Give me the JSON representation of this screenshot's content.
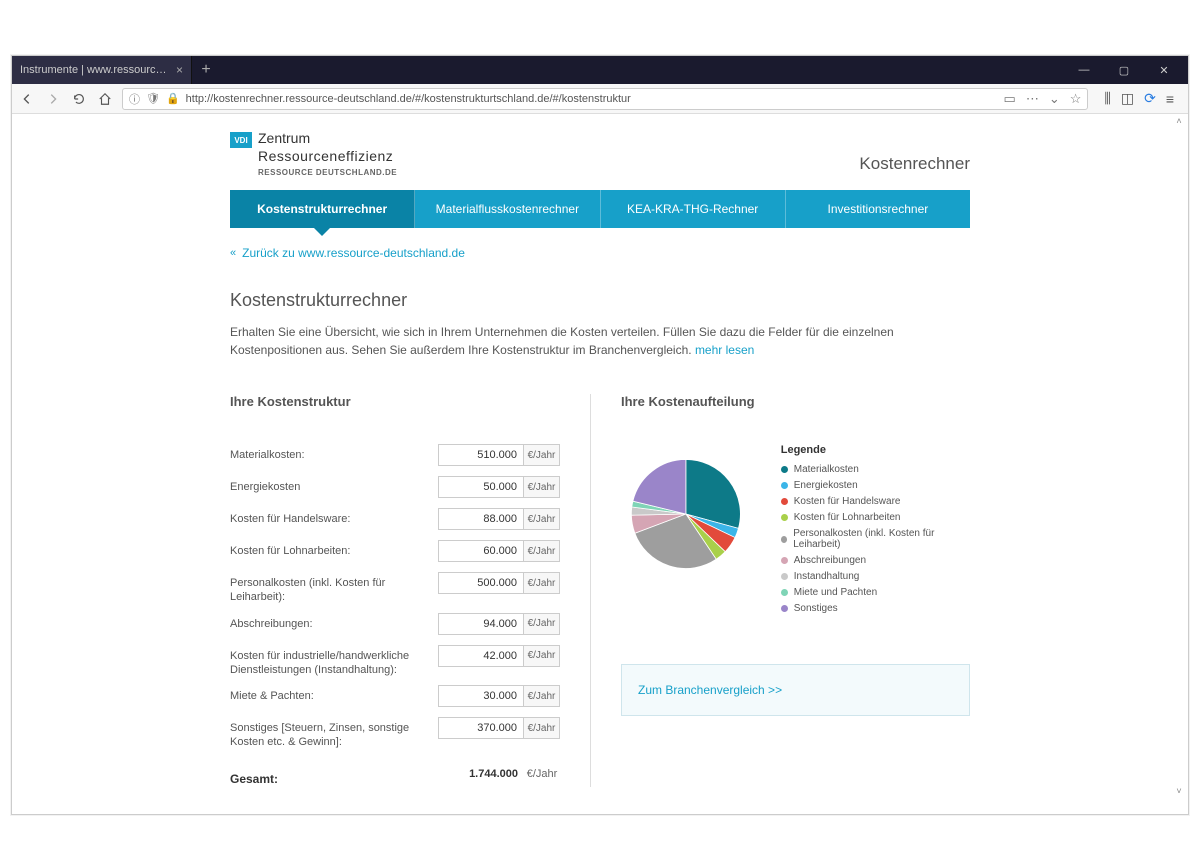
{
  "browser": {
    "tab_title": "Instrumente | www.ressource-deut",
    "url": "http://kostenrechner.ressource-deutschland.de/#/kostenstrukturtschland.de/#/kostenstruktur"
  },
  "brand": {
    "logo": "VDI",
    "line1": "Zentrum",
    "line2": "Ressourceneffizienz",
    "sub": "RESSOURCE DEUTSCHLAND.DE"
  },
  "header_title": "Kostenrechner",
  "nav": {
    "tabs": [
      {
        "label": "Kostenstrukturrechner"
      },
      {
        "label": "Materialflusskostenrechner"
      },
      {
        "label": "KEA-KRA-THG-Rechner"
      },
      {
        "label": "Investitionsrechner"
      }
    ]
  },
  "back_link": "Zurück zu www.ressource-deutschland.de",
  "section": {
    "title": "Kostenstrukturrechner",
    "desc": "Erhalten Sie eine Übersicht, wie sich in Ihrem Unternehmen die Kosten verteilen. Füllen Sie dazu die Felder für die einzelnen Kostenpositionen aus. Sehen Sie außerdem Ihre Kostenstruktur im Branchenvergleich.",
    "more": "mehr lesen"
  },
  "left_heading": "Ihre Kostenstruktur",
  "right_heading": "Ihre Kostenaufteilung",
  "unit": "€/Jahr",
  "costs": [
    {
      "label": "Materialkosten:",
      "value": "510.000"
    },
    {
      "label": "Energiekosten",
      "value": "50.000"
    },
    {
      "label": "Kosten für Handelsware:",
      "value": "88.000"
    },
    {
      "label": "Kosten für Lohnarbeiten:",
      "value": "60.000"
    },
    {
      "label": "Personalkosten (inkl. Kosten für Leiharbeit):",
      "value": "500.000"
    },
    {
      "label": "Abschreibungen:",
      "value": "94.000"
    },
    {
      "label": "Kosten für industrielle/handwerkliche Dienstleistungen (Instandhaltung):",
      "value": "42.000"
    },
    {
      "label": "Miete & Pachten:",
      "value": "30.000"
    },
    {
      "label": "Sonstiges [Steuern, Zinsen, sonstige Kosten etc. & Gewinn]:",
      "value": "370.000"
    }
  ],
  "total": {
    "label": "Gesamt:",
    "value": "1.744.000",
    "unit": "€/Jahr"
  },
  "legend_title": "Legende",
  "legend": [
    {
      "label": "Materialkosten",
      "color": "#0d7a88"
    },
    {
      "label": "Energiekosten",
      "color": "#3bb5e8"
    },
    {
      "label": "Kosten für Handelsware",
      "color": "#e24a3b"
    },
    {
      "label": "Kosten für Lohnarbeiten",
      "color": "#a9d04a"
    },
    {
      "label": "Personalkosten (inkl. Kosten für Leiharbeit)",
      "color": "#9e9e9e"
    },
    {
      "label": "Abschreibungen",
      "color": "#d5a5b4"
    },
    {
      "label": "Instandhaltung",
      "color": "#c9c9c9"
    },
    {
      "label": "Miete und Pachten",
      "color": "#7fd4b6"
    },
    {
      "label": "Sonstiges",
      "color": "#9a85c9"
    }
  ],
  "compare_link": "Zum Branchenvergleich >>",
  "chart_data": {
    "type": "pie",
    "title": "Ihre Kostenaufteilung",
    "series": [
      {
        "name": "Materialkosten",
        "value": 510000,
        "color": "#0d7a88"
      },
      {
        "name": "Energiekosten",
        "value": 50000,
        "color": "#3bb5e8"
      },
      {
        "name": "Kosten für Handelsware",
        "value": 88000,
        "color": "#e24a3b"
      },
      {
        "name": "Kosten für Lohnarbeiten",
        "value": 60000,
        "color": "#a9d04a"
      },
      {
        "name": "Personalkosten (inkl. Kosten für Leiharbeit)",
        "value": 500000,
        "color": "#9e9e9e"
      },
      {
        "name": "Abschreibungen",
        "value": 94000,
        "color": "#d5a5b4"
      },
      {
        "name": "Instandhaltung",
        "value": 42000,
        "color": "#c9c9c9"
      },
      {
        "name": "Miete und Pachten",
        "value": 30000,
        "color": "#7fd4b6"
      },
      {
        "name": "Sonstiges",
        "value": 370000,
        "color": "#9a85c9"
      }
    ]
  }
}
